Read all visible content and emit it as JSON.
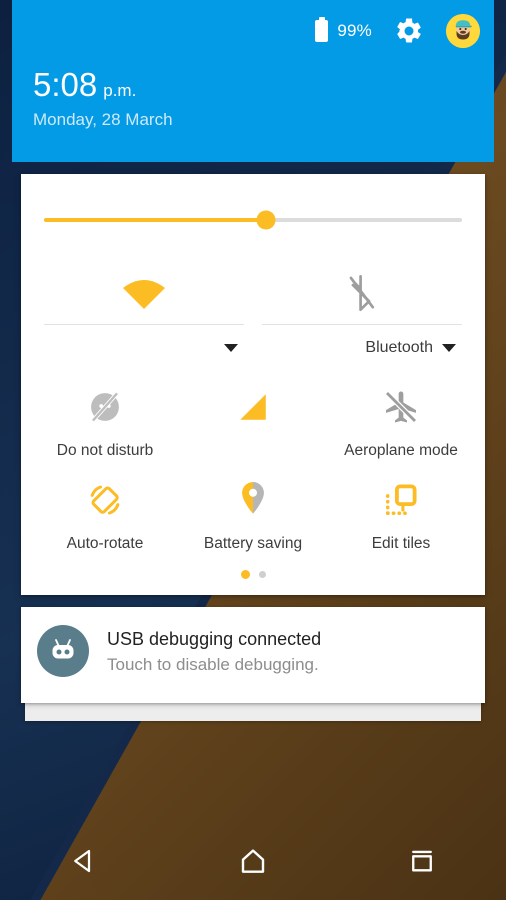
{
  "header": {
    "battery_percent": "99%",
    "battery_icon": "battery-full-icon",
    "settings_icon": "gear-icon",
    "avatar_icon": "user-avatar",
    "clock_time": "5:08",
    "clock_ampm": "p.m.",
    "clock_date": "Monday, 28 March",
    "accent_color": "#039BE5"
  },
  "brightness": {
    "name": "brightness-slider",
    "value_percent": 53,
    "fill_color": "#FBBC24",
    "track_color": "#DCDCDC"
  },
  "dual_tiles": [
    {
      "name": "wifi",
      "icon": "wifi-icon",
      "label": "",
      "enabled": true,
      "color": "#FBBC24"
    },
    {
      "name": "bluetooth",
      "icon": "bluetooth-off-icon",
      "label": "Bluetooth",
      "enabled": false,
      "color": "#9E9E9E"
    }
  ],
  "tiles": [
    {
      "name": "do-not-disturb",
      "icon": "do-not-disturb-icon",
      "label": "Do not disturb",
      "enabled": false,
      "color": "#BDBDBD"
    },
    {
      "name": "cellular-signal",
      "icon": "signal-bars-icon",
      "label": "",
      "enabled": true,
      "color": "#FBBC24"
    },
    {
      "name": "aeroplane-mode",
      "icon": "aeroplane-off-icon",
      "label": "Aeroplane mode",
      "enabled": false,
      "color": "#9E9E9E"
    },
    {
      "name": "auto-rotate",
      "icon": "auto-rotate-icon",
      "label": "Auto-rotate",
      "enabled": true,
      "color": "#FBBC24"
    },
    {
      "name": "battery-saving",
      "icon": "location-pin-icon",
      "label": "Battery saving",
      "enabled": true,
      "color": "#FBBC24"
    },
    {
      "name": "edit-tiles",
      "icon": "edit-tiles-icon",
      "label": "Edit tiles",
      "enabled": true,
      "color": "#FBBC24"
    }
  ],
  "pager": {
    "total_pages": 2,
    "current_page": 1,
    "active_color": "#FBBC24",
    "inactive_color": "#CFCFCF"
  },
  "notification": {
    "icon": "cyanogenmod-robot-icon",
    "title": "USB debugging connected",
    "subtitle": "Touch to disable debugging.",
    "icon_bg_color": "#5A7D8C"
  },
  "navbar": {
    "back": "back-icon",
    "home": "home-icon",
    "recents": "recents-icon"
  }
}
